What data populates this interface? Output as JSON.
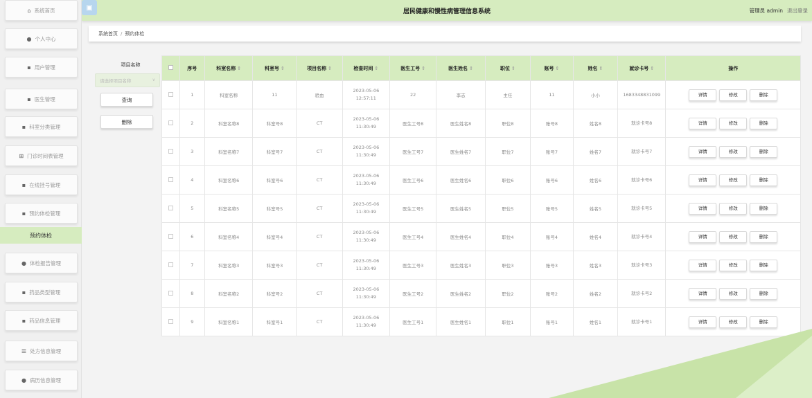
{
  "header": {
    "title": "居民健康和慢性病管理信息系统",
    "user": "管理员 admin",
    "logout": "退出登录"
  },
  "sidebar": {
    "items": [
      {
        "icon": "home-icon",
        "glyph": "⌂",
        "label": "系统首页"
      },
      {
        "icon": "user-icon",
        "glyph": "👤",
        "label": "个人中心"
      },
      {
        "icon": "grid-icon",
        "glyph": "▪",
        "label": "用户管理"
      },
      {
        "icon": "doctor-icon",
        "glyph": "▪",
        "label": "医生管理"
      },
      {
        "icon": "grid-icon",
        "glyph": "▪",
        "label": "科室分类管理"
      },
      {
        "icon": "table-icon",
        "glyph": "⊞",
        "label": "门诊时间表管理"
      },
      {
        "icon": "grid-icon",
        "glyph": "▪",
        "label": "在线挂号管理"
      },
      {
        "icon": "grid-icon",
        "glyph": "▪",
        "label": "预约体检管理"
      },
      {
        "icon": "person-icon",
        "glyph": "👤",
        "label": "体检报告管理"
      },
      {
        "icon": "chart-icon",
        "glyph": "▪",
        "label": "药品类型管理"
      },
      {
        "icon": "grid-icon",
        "glyph": "▪",
        "label": "药品信息管理"
      },
      {
        "icon": "sliders-icon",
        "glyph": "☰",
        "label": "处方信息管理"
      },
      {
        "icon": "pin-icon",
        "glyph": "●",
        "label": "病历信息管理"
      }
    ],
    "active_sub": "预约体检"
  },
  "breadcrumb": {
    "home": "系统首页",
    "current": "预约体检"
  },
  "search": {
    "label": "项目名称",
    "placeholder": "请选择项目名称",
    "query_button": "查询",
    "delete_button": "删除"
  },
  "table": {
    "headers": [
      "序号",
      "科室名称",
      "科室号",
      "项目名称",
      "检查时间",
      "医生工号",
      "医生姓名",
      "职位",
      "账号",
      "姓名",
      "就诊卡号",
      "操作"
    ],
    "rows": [
      [
        "1",
        "科室名称",
        "11",
        "验血",
        "2023-05-06 12:57:11",
        "22",
        "李志",
        "主任",
        "11",
        "小小",
        "1683348831099"
      ],
      [
        "2",
        "科室名称8",
        "科室号8",
        "CT",
        "2023-05-06 11:30:49",
        "医生工号8",
        "医生姓名8",
        "职位8",
        "账号8",
        "姓名8",
        "就诊卡号8"
      ],
      [
        "3",
        "科室名称7",
        "科室号7",
        "CT",
        "2023-05-06 11:30:49",
        "医生工号7",
        "医生姓名7",
        "职位7",
        "账号7",
        "姓名7",
        "就诊卡号7"
      ],
      [
        "4",
        "科室名称6",
        "科室号6",
        "CT",
        "2023-05-06 11:30:49",
        "医生工号6",
        "医生姓名6",
        "职位6",
        "账号6",
        "姓名6",
        "就诊卡号6"
      ],
      [
        "5",
        "科室名称5",
        "科室号5",
        "CT",
        "2023-05-06 11:30:49",
        "医生工号5",
        "医生姓名5",
        "职位5",
        "账号5",
        "姓名5",
        "就诊卡号5"
      ],
      [
        "6",
        "科室名称4",
        "科室号4",
        "CT",
        "2023-05-06 11:30:49",
        "医生工号4",
        "医生姓名4",
        "职位4",
        "账号4",
        "姓名4",
        "就诊卡号4"
      ],
      [
        "7",
        "科室名称3",
        "科室号3",
        "CT",
        "2023-05-06 11:30:49",
        "医生工号3",
        "医生姓名3",
        "职位3",
        "账号3",
        "姓名3",
        "就诊卡号3"
      ],
      [
        "8",
        "科室名称2",
        "科室号2",
        "CT",
        "2023-05-06 11:30:49",
        "医生工号2",
        "医生姓名2",
        "职位2",
        "账号2",
        "姓名2",
        "就诊卡号2"
      ],
      [
        "9",
        "科室名称1",
        "科室号1",
        "CT",
        "2023-05-06 11:30:49",
        "医生工号1",
        "医生姓名1",
        "职位1",
        "账号1",
        "姓名1",
        "就诊卡号1"
      ]
    ],
    "actions": [
      "详情",
      "修改",
      "删除"
    ]
  },
  "colors": {
    "accent": "#d6ecbf",
    "deco": "#c8e3a8"
  }
}
